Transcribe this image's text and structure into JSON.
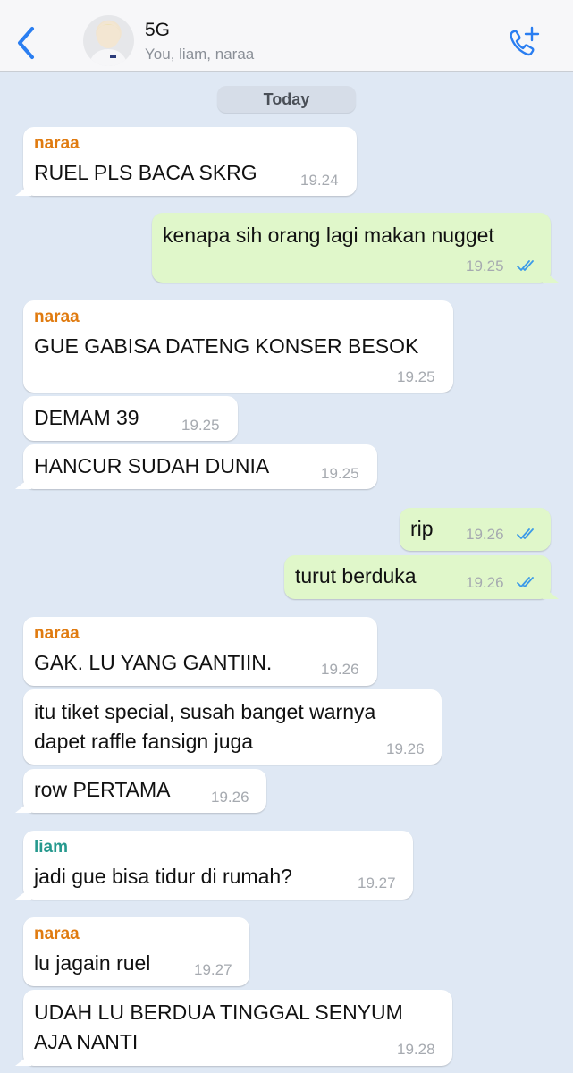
{
  "header": {
    "title": "5G",
    "subtitle": "You, liam, naraa"
  },
  "date_label": "Today",
  "colors": {
    "background": "#dfe8f4",
    "incoming_bubble": "#ffffff",
    "outgoing_bubble": "#e0f7ca",
    "accent": "#2a7ef1",
    "sender_naraa": "#e07b10",
    "sender_liam": "#26998e",
    "read_ticks": "#3b9ae8"
  },
  "messages": [
    {
      "sender": "naraa",
      "text": "RUEL PLS BACA SKRG",
      "time": "19.24"
    },
    {
      "text": "kenapa sih orang lagi makan nugget",
      "time": "19.25",
      "status": "read"
    },
    {
      "sender": "naraa",
      "text": "GUE GABISA DATENG KONSER BESOK",
      "time": "19.25"
    },
    {
      "text": "DEMAM 39",
      "time": "19.25"
    },
    {
      "text": "HANCUR SUDAH DUNIA",
      "time": "19.25"
    },
    {
      "text": "rip",
      "time": "19.26",
      "status": "read"
    },
    {
      "text": "turut berduka",
      "time": "19.26",
      "status": "read"
    },
    {
      "sender": "naraa",
      "text": "GAK. LU YANG GANTIIN.",
      "time": "19.26"
    },
    {
      "text": "itu tiket special, susah banget warnya\ndapet raffle fansign juga",
      "time": "19.26"
    },
    {
      "text": "row PERTAMA",
      "time": "19.26"
    },
    {
      "sender": "liam",
      "text": "jadi gue bisa tidur di rumah?",
      "time": "19.27"
    },
    {
      "sender": "naraa",
      "text": "lu jagain ruel",
      "time": "19.27"
    },
    {
      "text": "UDAH LU BERDUA TINGGAL SENYUM\nAJA NANTI",
      "time": "19.28"
    }
  ]
}
